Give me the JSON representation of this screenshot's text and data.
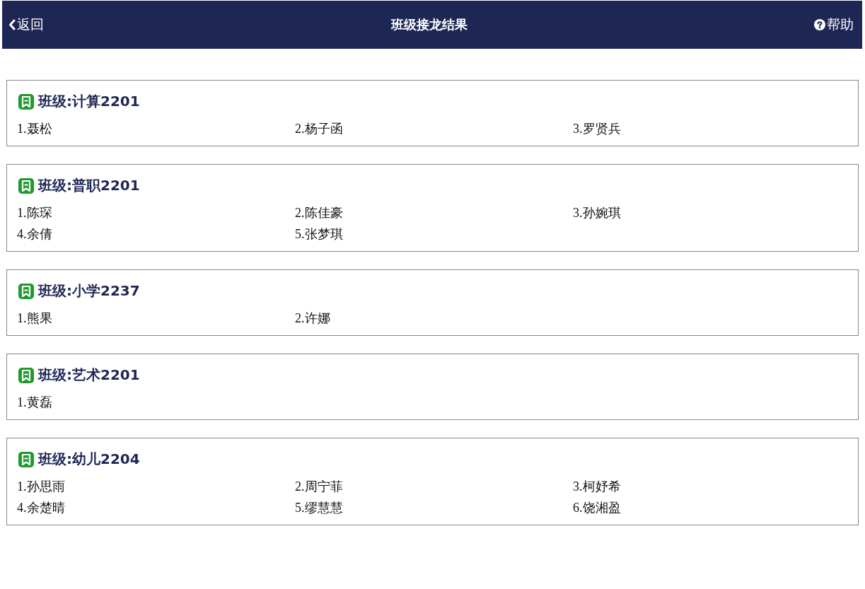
{
  "header": {
    "back": "返回",
    "title": "班级接龙结果",
    "help": "帮助"
  },
  "classes": [
    {
      "title": "班级:计算2201",
      "members": [
        "1.聂松",
        "2.杨子函",
        "3.罗贤兵"
      ]
    },
    {
      "title": "班级:普职2201",
      "members": [
        "1.陈琛",
        "2.陈佳豪",
        "3.孙婉琪",
        "4.余倩",
        "5.张梦琪"
      ]
    },
    {
      "title": "班级:小学2237",
      "members": [
        "1.熊果",
        "2.许娜"
      ]
    },
    {
      "title": "班级:艺术2201",
      "members": [
        "1.黄磊"
      ]
    },
    {
      "title": "班级:幼儿2204",
      "members": [
        "1.孙思雨",
        "2.周宁菲",
        "3.柯妤希",
        "4.余楚晴",
        "5.缪慧慧",
        "6.饶湘盈"
      ]
    }
  ]
}
